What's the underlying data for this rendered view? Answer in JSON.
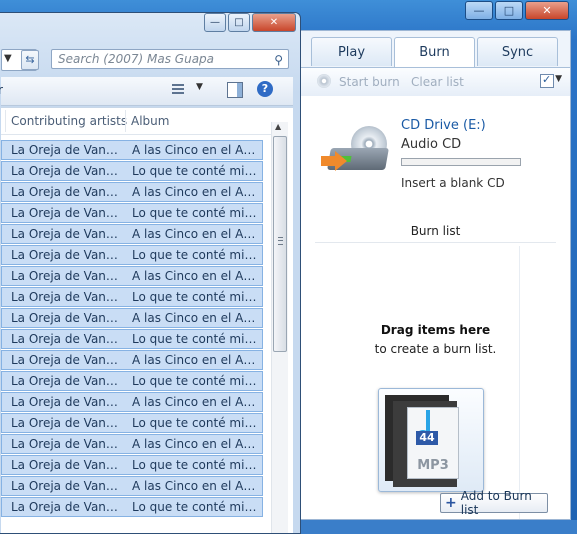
{
  "wmp": {
    "tabs": [
      {
        "label": "Play"
      },
      {
        "label": "Burn"
      },
      {
        "label": "Sync"
      }
    ],
    "toolbar": {
      "start_burn": "Start burn",
      "clear_list": "Clear list"
    },
    "drive": {
      "name": "CD Drive (E:)",
      "type": "Audio CD",
      "status": "Insert a blank CD",
      "progress": 0
    },
    "burn_list_heading": "Burn list",
    "drag_hint_bold": "Drag items here",
    "drag_hint": "to create a burn list.",
    "drag_thumb": {
      "badge": "44",
      "label": "MP3"
    },
    "add_button": "Add to Burn list"
  },
  "explorer": {
    "search_placeholder": "Search (2007) Mas Guapa",
    "cmd_partial": "r",
    "columns": [
      "Contributing artists",
      "Album"
    ],
    "rows": [
      {
        "artist": "La Oreja de Van G...",
        "album": "A las Cinco en el Ast..."
      },
      {
        "artist": "La Oreja de Van G...",
        "album": "Lo que te conté mien..."
      },
      {
        "artist": "La Oreja de Van G...",
        "album": "A las Cinco en el Ast..."
      },
      {
        "artist": "La Oreja de Van G...",
        "album": "Lo que te conté mien..."
      },
      {
        "artist": "La Oreja de Van G...",
        "album": "A las Cinco en el Ast..."
      },
      {
        "artist": "La Oreja de Van G...",
        "album": "Lo que te conté mien..."
      },
      {
        "artist": "La Oreja de Van G...",
        "album": "A las Cinco en el Ast..."
      },
      {
        "artist": "La Oreja de Van G...",
        "album": "Lo que te conté mien..."
      },
      {
        "artist": "La Oreja de Van G...",
        "album": "A las Cinco en el Ast..."
      },
      {
        "artist": "La Oreja de Van G...",
        "album": "Lo que te conté mien..."
      },
      {
        "artist": "La Oreja de Van G...",
        "album": "A las Cinco en el Ast..."
      },
      {
        "artist": "La Oreja de Van G...",
        "album": "Lo que te conté mien..."
      },
      {
        "artist": "La Oreja de Van G...",
        "album": "A las Cinco en el Ast..."
      },
      {
        "artist": "La Oreja de Van G...",
        "album": "Lo que te conté mien..."
      },
      {
        "artist": "La Oreja de Van G...",
        "album": "A las Cinco en el Ast..."
      },
      {
        "artist": "La Oreja de Van G...",
        "album": "Lo que te conté mien..."
      },
      {
        "artist": "La Oreja de Van G...",
        "album": "A las Cinco en el Ast..."
      },
      {
        "artist": "La Oreja de Van G...",
        "album": "Lo que te conté mien..."
      }
    ]
  }
}
